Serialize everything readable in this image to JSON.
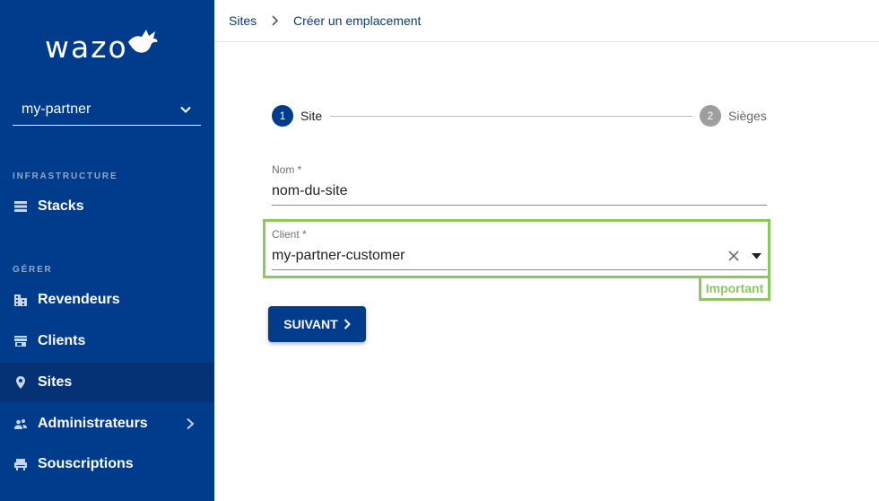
{
  "sidebar": {
    "logo_text": "wazo",
    "selector": {
      "value": "my-partner"
    },
    "sections": [
      {
        "label": "INFRASTRUCTURE"
      },
      {
        "label": "GÉRER"
      }
    ],
    "items": [
      {
        "label": "Stacks",
        "icon": "list-icon"
      },
      {
        "label": "Revendeurs",
        "icon": "building-icon"
      },
      {
        "label": "Clients",
        "icon": "store-icon"
      },
      {
        "label": "Sites",
        "icon": "location-pin-icon",
        "active": true
      },
      {
        "label": "Administrateurs",
        "icon": "people-icon"
      },
      {
        "label": "Souscriptions",
        "icon": "chair-icon"
      }
    ]
  },
  "breadcrumb": {
    "items": [
      "Sites",
      "Créer un emplacement"
    ]
  },
  "stepper": {
    "steps": [
      {
        "number": "1",
        "label": "Site"
      },
      {
        "number": "2",
        "label": "Sièges"
      }
    ]
  },
  "form": {
    "name": {
      "label": "Nom *",
      "value": "nom-du-site"
    },
    "client": {
      "label": "Client *",
      "value": "my-partner-customer"
    }
  },
  "annotation": {
    "label": "Important"
  },
  "next_button": {
    "label": "SUIVANT"
  },
  "colors": {
    "sidebar": "#003b8c",
    "active_item": "#053275",
    "annotation": "#8dc85f"
  }
}
